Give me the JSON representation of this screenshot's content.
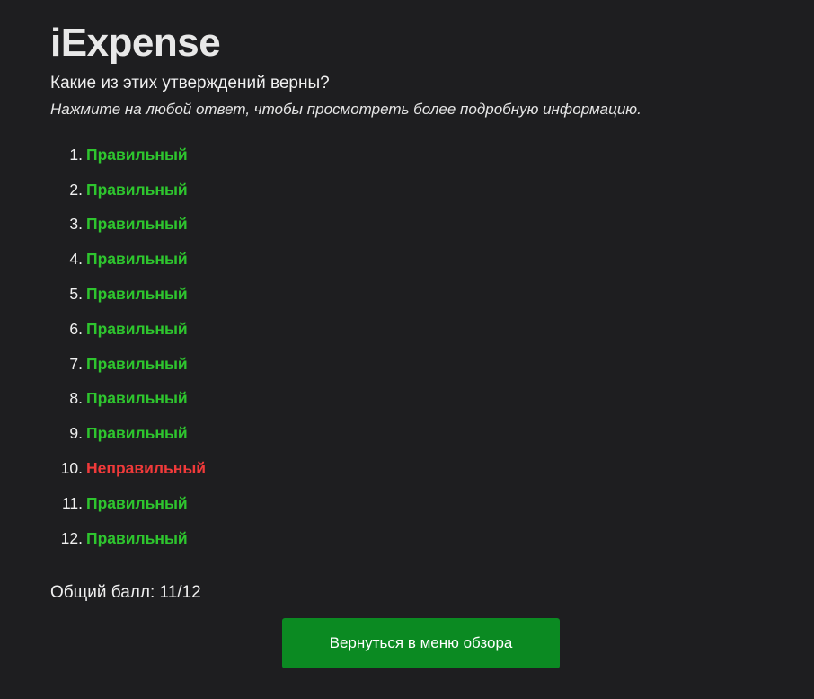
{
  "app": {
    "title": "iExpense"
  },
  "quiz": {
    "question": "Какие из этих утверждений верны?",
    "hint": "Нажмите на любой ответ, чтобы просмотреть более подробную информацию.",
    "answers": [
      {
        "number": "1.",
        "result": "Правильный",
        "correct": true
      },
      {
        "number": "2.",
        "result": "Правильный",
        "correct": true
      },
      {
        "number": "3.",
        "result": "Правильный",
        "correct": true
      },
      {
        "number": "4.",
        "result": "Правильный",
        "correct": true
      },
      {
        "number": "5.",
        "result": "Правильный",
        "correct": true
      },
      {
        "number": "6.",
        "result": "Правильный",
        "correct": true
      },
      {
        "number": "7.",
        "result": "Правильный",
        "correct": true
      },
      {
        "number": "8.",
        "result": "Правильный",
        "correct": true
      },
      {
        "number": "9.",
        "result": "Правильный",
        "correct": true
      },
      {
        "number": "10.",
        "result": "Неправильный",
        "correct": false
      },
      {
        "number": "11.",
        "result": "Правильный",
        "correct": true
      },
      {
        "number": "12.",
        "result": "Правильный",
        "correct": true
      }
    ],
    "score_text": "Общий балл: 11/12"
  },
  "actions": {
    "back_label": "Вернуться в меню обзора"
  },
  "colors": {
    "correct": "#2ec52e",
    "incorrect": "#f03a3a",
    "button": "#0b8a22",
    "background": "#1e1e20"
  }
}
